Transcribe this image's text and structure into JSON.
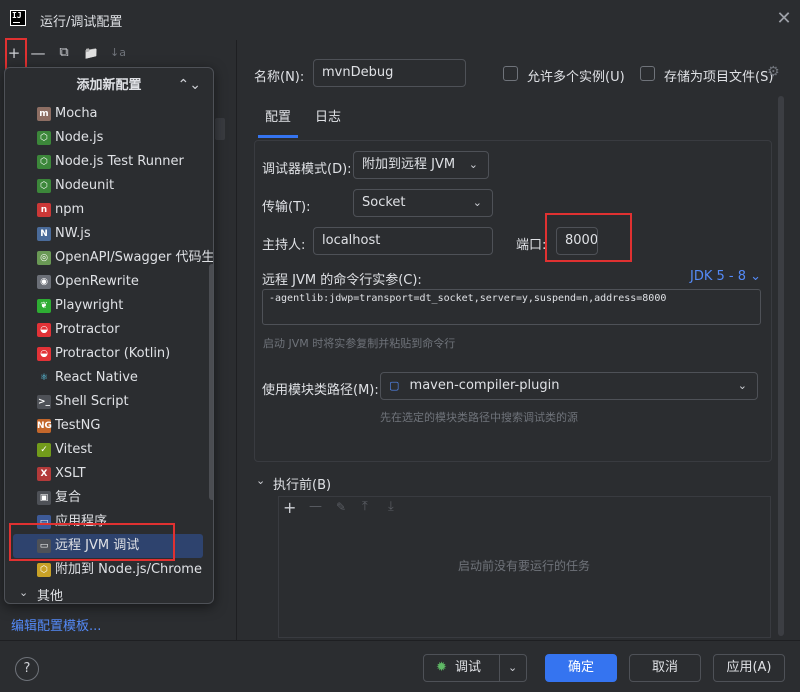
{
  "window": {
    "title": "运行/调试配置",
    "logo_text": "IJ"
  },
  "left_toolbar": {
    "add": "+",
    "remove": "—",
    "copy": "⧉",
    "folder": "📁",
    "sort": "↓a"
  },
  "popup": {
    "header": "添加新配置",
    "items": [
      {
        "label": "Mocha",
        "icon": "mocha-icon",
        "icon_char": "m",
        "color": "#8d6e63"
      },
      {
        "label": "Node.js",
        "icon": "nodejs-icon",
        "icon_char": "⬡",
        "color": "#3c873a"
      },
      {
        "label": "Node.js Test Runner",
        "icon": "nodejs-test-icon",
        "icon_char": "⬡",
        "color": "#3c873a"
      },
      {
        "label": "Nodeunit",
        "icon": "nodeunit-icon",
        "icon_char": "⬡",
        "color": "#3c873a"
      },
      {
        "label": "npm",
        "icon": "npm-icon",
        "icon_char": "n",
        "color": "#cb3837"
      },
      {
        "label": "NW.js",
        "icon": "nwjs-icon",
        "icon_char": "N",
        "color": "#4a6b9a"
      },
      {
        "label": "OpenAPI/Swagger 代码生成",
        "icon": "openapi-icon",
        "icon_char": "◎",
        "color": "#6a9955"
      },
      {
        "label": "OpenRewrite",
        "icon": "openrewrite-icon",
        "icon_char": "◉",
        "color": "#6b6f77"
      },
      {
        "label": "Playwright",
        "icon": "playwright-icon",
        "icon_char": "❦",
        "color": "#2ead33"
      },
      {
        "label": "Protractor",
        "icon": "protractor-icon",
        "icon_char": "◒",
        "color": "#e23237"
      },
      {
        "label": "Protractor (Kotlin)",
        "icon": "protractor-kotlin-icon",
        "icon_char": "◒",
        "color": "#e23237"
      },
      {
        "label": "React Native",
        "icon": "react-icon",
        "icon_char": "⚛",
        "color": "#2b2d30",
        "fg": "#61dafb"
      },
      {
        "label": "Shell Script",
        "icon": "shell-icon",
        "icon_char": ">_",
        "color": "#4e5157"
      },
      {
        "label": "TestNG",
        "icon": "testng-icon",
        "icon_char": "NG",
        "color": "#c4672b"
      },
      {
        "label": "Vitest",
        "icon": "vitest-icon",
        "icon_char": "✓",
        "color": "#729b1b"
      },
      {
        "label": "XSLT",
        "icon": "xslt-icon",
        "icon_char": "X",
        "color": "#b33a3a"
      },
      {
        "label": "复合",
        "icon": "compound-icon",
        "icon_char": "▣",
        "color": "#4e5157"
      },
      {
        "label": "应用程序",
        "icon": "application-icon",
        "icon_char": "▭",
        "color": "#3d5a98"
      },
      {
        "label": "远程 JVM 调试",
        "icon": "remote-jvm-icon",
        "icon_char": "▭",
        "color": "#4e5157"
      },
      {
        "label": "附加到 Node.js/Chrome",
        "icon": "attach-nodejs-icon",
        "icon_char": "⬡",
        "color": "#c9a227"
      }
    ],
    "other_label": "其他"
  },
  "edit_templates_link": "编辑配置模板...",
  "form": {
    "name_label": "名称(N):",
    "name_value": "mvnDebug",
    "allow_multiple_label": "允许多个实例(U)",
    "store_as_project_label": "存储为项目文件(S)",
    "tabs": [
      "配置",
      "日志"
    ],
    "debugger_mode_label": "调试器模式(D):",
    "debugger_mode_value": "附加到远程 JVM",
    "transport_label": "传输(T):",
    "transport_value": "Socket",
    "host_label": "主持人:",
    "host_value": "localhost",
    "port_label": "端口:",
    "port_value": "8000",
    "cmdline_label": "远程 JVM 的命令行实参(C):",
    "jdk_label": "JDK 5 - 8",
    "cmdline_value": "-agentlib:jdwp=transport=dt_socket,server=y,suspend=n,address=8000",
    "cmdline_hint": "启动 JVM 时将实参复制并粘贴到命令行",
    "module_label": "使用模块类路径(M):",
    "module_value": "maven-compiler-plugin",
    "module_hint": "先在选定的模块类路径中搜索调试类的源",
    "before_launch_label": "执行前(B)",
    "before_launch_empty": "启动前没有要运行的任务"
  },
  "footer": {
    "help": "?",
    "debug_label": "调试",
    "ok_label": "确定",
    "cancel_label": "取消",
    "apply_label": "应用(A)"
  }
}
